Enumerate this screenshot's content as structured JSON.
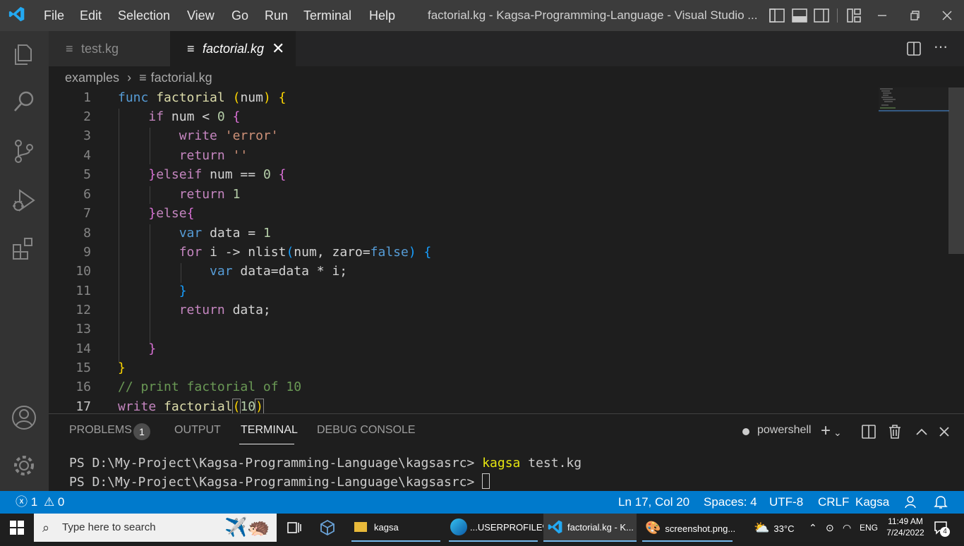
{
  "titlebar": {
    "menu": [
      "File",
      "Edit",
      "Selection",
      "View",
      "Go",
      "Run",
      "Terminal",
      "Help"
    ],
    "window_title": "factorial.kg - Kagsa-Programming-Language - Visual Studio ...",
    "icons": [
      "vscode-logo-icon",
      "toggle-sidebar-icon",
      "toggle-panel-icon",
      "toggle-secondary-sidebar-icon",
      "customize-layout-icon",
      "minimize-icon",
      "restore-icon",
      "close-icon"
    ]
  },
  "activity_bar": {
    "items": [
      "explorer-icon",
      "search-icon",
      "source-control-icon",
      "run-debug-icon",
      "extensions-icon",
      "accounts-icon",
      "manage-gear-icon"
    ]
  },
  "tabs": [
    {
      "label": "test.kg",
      "active": false
    },
    {
      "label": "factorial.kg",
      "active": true,
      "close": "✕"
    }
  ],
  "breadcrumb": {
    "folder": "examples",
    "separator": "›",
    "file": "factorial.kg"
  },
  "editor": {
    "lines": [
      "1",
      "2",
      "3",
      "4",
      "5",
      "6",
      "7",
      "8",
      "9",
      "10",
      "11",
      "12",
      "13",
      "14",
      "15",
      "16",
      "17"
    ],
    "tokens": {
      "func": "func",
      "factorial": "factorial",
      "sp": " ",
      "lparen": "(",
      "rparen": ")",
      "num": "num",
      "lbrace": "{",
      "rbrace": "}",
      "if": "if",
      "lt": " < ",
      "zero": "0",
      "one": "1",
      "ten": "10",
      "write": "write",
      "return": "return",
      "error_str": "'error'",
      "empty_str": "''",
      "elseif": "elseif",
      "eqeq": " == ",
      "else": "else",
      "var": "var",
      "data": "data",
      "assign": " = ",
      "for": "for",
      "i": "i",
      "arrow": " -> ",
      "nlist": "nlist",
      "comma_zaro": ", zaro=",
      "false": "false",
      "data_assign": "data=data * i;",
      "data_semi": "data;",
      "comment": "// print factorial of 10"
    }
  },
  "panel": {
    "tabs": [
      "PROBLEMS",
      "OUTPUT",
      "TERMINAL",
      "DEBUG CONSOLE"
    ],
    "problems_count": "1",
    "shell": "powershell",
    "terminal_prompt": "PS D:\\My-Project\\Kagsa-Programming-Language\\kagsasrc> ",
    "terminal_cmd_name": "kagsa",
    "terminal_cmd_arg": " test.kg"
  },
  "statusbar": {
    "errors": "1",
    "warnings": "0",
    "position": "Ln 17, Col 20",
    "spaces": "Spaces: 4",
    "encoding": "UTF-8",
    "eol": "CRLF",
    "language": "Kagsa"
  },
  "taskbar": {
    "search_placeholder": "Type here to search",
    "apps": [
      {
        "label": "kagsa"
      },
      {
        "label": "...USERPROFILE%"
      },
      {
        "label": "factorial.kg - K..."
      },
      {
        "label": "screenshot.png..."
      }
    ],
    "temperature": "33°C",
    "language": "ENG",
    "time": "11:49 AM",
    "date": "7/24/2022",
    "notifications": "4"
  },
  "colors": {
    "accent": "#007acc",
    "keyword": "#c586c0",
    "storage": "#569cd6",
    "function": "#dcdcaa",
    "string": "#ce9178",
    "number": "#b5cea8",
    "comment": "#6a9955"
  }
}
